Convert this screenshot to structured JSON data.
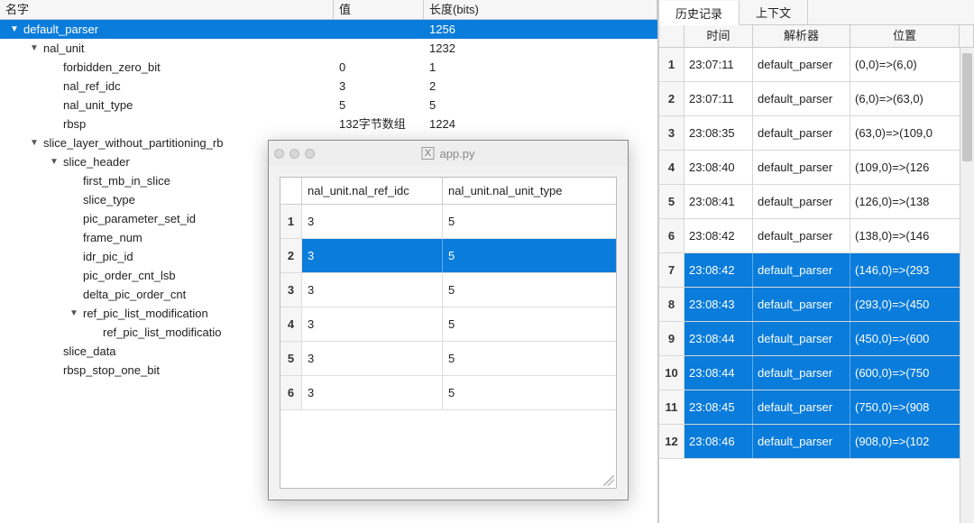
{
  "tree": {
    "headers": {
      "name": "名字",
      "value": "值",
      "length": "长度(bits)"
    },
    "rows": [
      {
        "indent": 0,
        "arrow": "down",
        "name": "default_parser",
        "value": "",
        "length": "1256",
        "selected": true
      },
      {
        "indent": 1,
        "arrow": "down",
        "name": "nal_unit",
        "value": "",
        "length": "1232"
      },
      {
        "indent": 2,
        "arrow": "none",
        "name": "forbidden_zero_bit",
        "value": "0",
        "length": "1"
      },
      {
        "indent": 2,
        "arrow": "none",
        "name": "nal_ref_idc",
        "value": "3",
        "length": "2"
      },
      {
        "indent": 2,
        "arrow": "none",
        "name": "nal_unit_type",
        "value": "5",
        "length": "5"
      },
      {
        "indent": 2,
        "arrow": "none",
        "name": "rbsp",
        "value": "132字节数组",
        "length": "1224"
      },
      {
        "indent": 1,
        "arrow": "down",
        "name": "slice_layer_without_partitioning_rb",
        "value": "",
        "length": ""
      },
      {
        "indent": 2,
        "arrow": "down",
        "name": "slice_header",
        "value": "",
        "length": ""
      },
      {
        "indent": 3,
        "arrow": "none",
        "name": "first_mb_in_slice",
        "value": "",
        "length": ""
      },
      {
        "indent": 3,
        "arrow": "none",
        "name": "slice_type",
        "value": "",
        "length": ""
      },
      {
        "indent": 3,
        "arrow": "none",
        "name": "pic_parameter_set_id",
        "value": "",
        "length": ""
      },
      {
        "indent": 3,
        "arrow": "none",
        "name": "frame_num",
        "value": "",
        "length": ""
      },
      {
        "indent": 3,
        "arrow": "none",
        "name": "idr_pic_id",
        "value": "",
        "length": ""
      },
      {
        "indent": 3,
        "arrow": "none",
        "name": "pic_order_cnt_lsb",
        "value": "",
        "length": ""
      },
      {
        "indent": 3,
        "arrow": "none",
        "name": "delta_pic_order_cnt",
        "value": "",
        "length": ""
      },
      {
        "indent": 3,
        "arrow": "down",
        "name": "ref_pic_list_modification",
        "value": "",
        "length": ""
      },
      {
        "indent": 4,
        "arrow": "none",
        "name": "ref_pic_list_modificatio",
        "value": "",
        "length": ""
      },
      {
        "indent": 2,
        "arrow": "none",
        "name": "slice_data",
        "value": "",
        "length": ""
      },
      {
        "indent": 2,
        "arrow": "none",
        "name": "rbsp_stop_one_bit",
        "value": "",
        "length": ""
      }
    ]
  },
  "tabs": {
    "history": "历史记录",
    "context": "上下文"
  },
  "history": {
    "headers": {
      "time": "时间",
      "parser": "解析器",
      "position": "位置"
    },
    "rows": [
      {
        "idx": "1",
        "time": "23:07:11",
        "parser": "default_parser",
        "pos": "(0,0)=>(6,0)"
      },
      {
        "idx": "2",
        "time": "23:07:11",
        "parser": "default_parser",
        "pos": "(6,0)=>(63,0)"
      },
      {
        "idx": "3",
        "time": "23:08:35",
        "parser": "default_parser",
        "pos": "(63,0)=>(109,0"
      },
      {
        "idx": "4",
        "time": "23:08:40",
        "parser": "default_parser",
        "pos": "(109,0)=>(126"
      },
      {
        "idx": "5",
        "time": "23:08:41",
        "parser": "default_parser",
        "pos": "(126,0)=>(138"
      },
      {
        "idx": "6",
        "time": "23:08:42",
        "parser": "default_parser",
        "pos": "(138,0)=>(146"
      },
      {
        "idx": "7",
        "time": "23:08:42",
        "parser": "default_parser",
        "pos": "(146,0)=>(293",
        "sel": true
      },
      {
        "idx": "8",
        "time": "23:08:43",
        "parser": "default_parser",
        "pos": "(293,0)=>(450",
        "sel": true
      },
      {
        "idx": "9",
        "time": "23:08:44",
        "parser": "default_parser",
        "pos": "(450,0)=>(600",
        "sel": true
      },
      {
        "idx": "10",
        "time": "23:08:44",
        "parser": "default_parser",
        "pos": "(600,0)=>(750",
        "sel": true
      },
      {
        "idx": "11",
        "time": "23:08:45",
        "parser": "default_parser",
        "pos": "(750,0)=>(908",
        "sel": true
      },
      {
        "idx": "12",
        "time": "23:08:46",
        "parser": "default_parser",
        "pos": "(908,0)=>(102",
        "sel": true
      }
    ]
  },
  "popup": {
    "title": "app.py",
    "headers": {
      "c1": "nal_unit.nal_ref_idc",
      "c2": "nal_unit.nal_unit_type"
    },
    "rows": [
      {
        "idx": "1",
        "c1": "3",
        "c2": "5"
      },
      {
        "idx": "2",
        "c1": "3",
        "c2": "5",
        "sel": true
      },
      {
        "idx": "3",
        "c1": "3",
        "c2": "5"
      },
      {
        "idx": "4",
        "c1": "3",
        "c2": "5"
      },
      {
        "idx": "5",
        "c1": "3",
        "c2": "5"
      },
      {
        "idx": "6",
        "c1": "3",
        "c2": "5"
      }
    ]
  }
}
